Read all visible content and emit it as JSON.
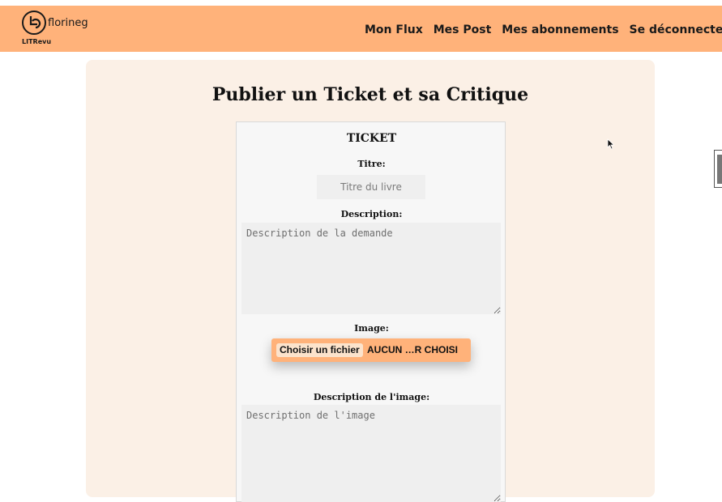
{
  "header": {
    "logo_user": "florineg",
    "logo_brand": "LITRevu",
    "nav": [
      "Mon Flux",
      "Mes Post",
      "Mes abonnements",
      "Se déconnecter"
    ],
    "background": "#ffb27a"
  },
  "page": {
    "title": "Publier un Ticket et sa Critique"
  },
  "ticket_form": {
    "heading": "TICKET",
    "title_label": "Titre:",
    "title_placeholder": "Titre du livre",
    "description_label": "Description:",
    "description_placeholder": "Description de la demande",
    "image_label": "Image:",
    "file_button_label": "Choisir un fichier",
    "file_status": "AUCUN …R CHOISI",
    "image_description_label": "Description de l'image:",
    "image_description_placeholder": "Description de l'image"
  },
  "icons": {
    "logo": "litrevu-logo-icon",
    "cursor": "mouse-pointer-icon"
  },
  "colors": {
    "accent": "#ffb27a",
    "main_background": "#fbf0e6",
    "form_background": "#f7f7f7"
  }
}
